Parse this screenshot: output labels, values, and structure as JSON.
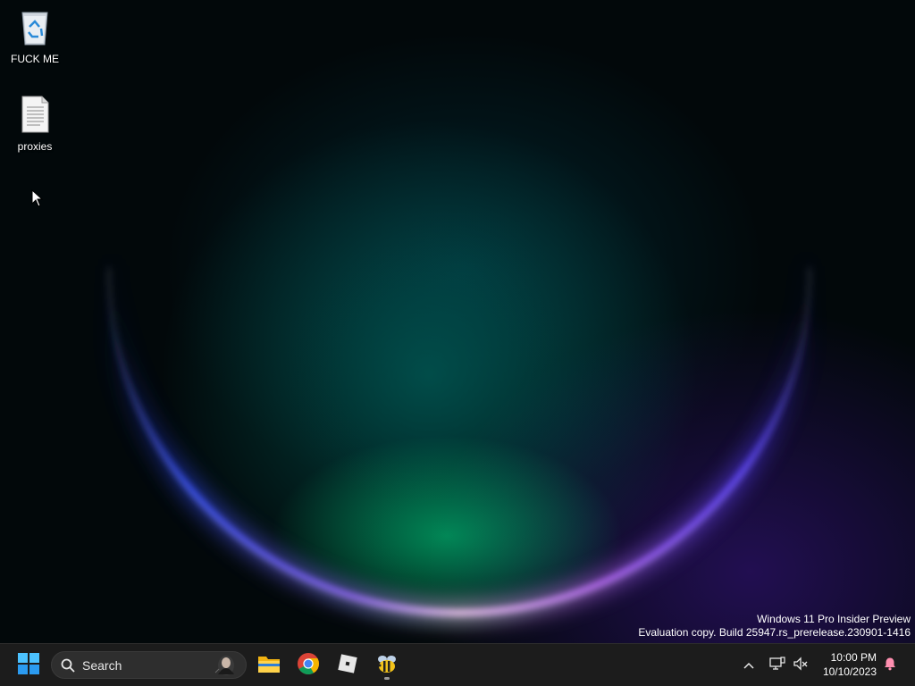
{
  "desktop": {
    "icons": [
      {
        "label": "FUCK ME",
        "icon": "recycle-bin-icon"
      },
      {
        "label": "proxies",
        "icon": "text-document-icon"
      }
    ],
    "watermark": {
      "line1": "Windows 11 Pro Insider Preview",
      "line2": "Evaluation copy. Build 25947.rs_prerelease.230901-1416"
    }
  },
  "taskbar": {
    "start": {
      "icon": "windows-logo-icon"
    },
    "search": {
      "placeholder": "Search",
      "icon": "search-icon"
    },
    "pinned": [
      {
        "name": "File Explorer",
        "icon": "folder-icon",
        "running": false
      },
      {
        "name": "Google Chrome",
        "icon": "chrome-icon",
        "running": false
      },
      {
        "name": "Roblox",
        "icon": "roblox-icon",
        "running": false
      },
      {
        "name": "App",
        "icon": "bee-icon",
        "running": true
      }
    ],
    "tray": {
      "icons": [
        "chevron-up-icon",
        "network-icon",
        "volume-muted-icon",
        "notification-bell-icon"
      ],
      "time": "10:00 PM",
      "date": "10/10/2023"
    }
  },
  "colors": {
    "taskbar_bg": "#1c1c1c",
    "accent": "#0078d4",
    "notification": "#ff8fb0"
  }
}
